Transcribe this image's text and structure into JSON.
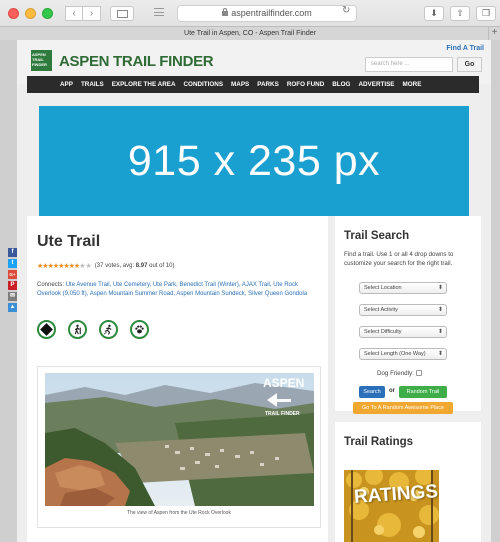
{
  "browser": {
    "url": "aspentrailfinder.com",
    "tab_title": "Ute Trail in Aspen, CO - Aspen Trail Finder",
    "new_tab": "+"
  },
  "header": {
    "logo_box": "ASPEN TRAIL FINDER",
    "logo_text": "ASPEN TRAIL FINDER",
    "find_trail": "Find A Trail",
    "search_placeholder": "search here ...",
    "go": "Go"
  },
  "nav": [
    "APP",
    "TRAILS",
    "EXPLORE THE AREA",
    "CONDITIONS",
    "MAPS",
    "PARKS",
    "ROFO FUND",
    "BLOG",
    "ADVERTISE",
    "MORE"
  ],
  "banner": "915 x 235 px",
  "trail": {
    "title": "Ute Trail",
    "votes": "(37 votes, avg: ",
    "avg": "8.97",
    "out_of": " out of 10)",
    "rating": 8.97,
    "connects_label": "Connects: ",
    "connects": "Ute Avenue Trail, Ute Cemetery, Ute Park, Benedict Trail (Winter), AJAX Trail, Ute Rock Overlook (9,050 ft), Aspen Mountain Summer Road, Aspen Mountain Sundeck, Silver Queen Gondola",
    "badges": [
      "difficulty-diamond-icon",
      "hiker-icon",
      "runner-icon",
      "paw-icon"
    ],
    "photo_logo_top": "ASPEN",
    "photo_logo_bottom": "TRAIL FINDER",
    "caption": "The view of Aspen from the Ute Rock Overlook"
  },
  "sidebar": {
    "search_title": "Trail Search",
    "search_desc": "Find a trail. Use 1 or all 4 drop downs to customize your search for the right trail.",
    "selects": [
      "Select Location",
      "Select Activity",
      "Select Difficulty",
      "Select Length (One Way)"
    ],
    "dog_label": "Dog Friendly:",
    "search_btn": "Search",
    "or": "or",
    "random_btn": "Random Trail",
    "awesome_btn": "Go To A Random Awesome Place",
    "ratings_title": "Trail Ratings",
    "ratings_img_text": "RATINGS"
  },
  "social": [
    "f",
    "t",
    "G+",
    "P",
    "✉",
    "▲"
  ],
  "colors": {
    "brand_green": "#2f7a3d",
    "link_blue": "#2a6fb7",
    "banner_blue": "#1aa0d0",
    "nav_dark": "#2b2b2b",
    "star_orange": "#e88a1a"
  }
}
